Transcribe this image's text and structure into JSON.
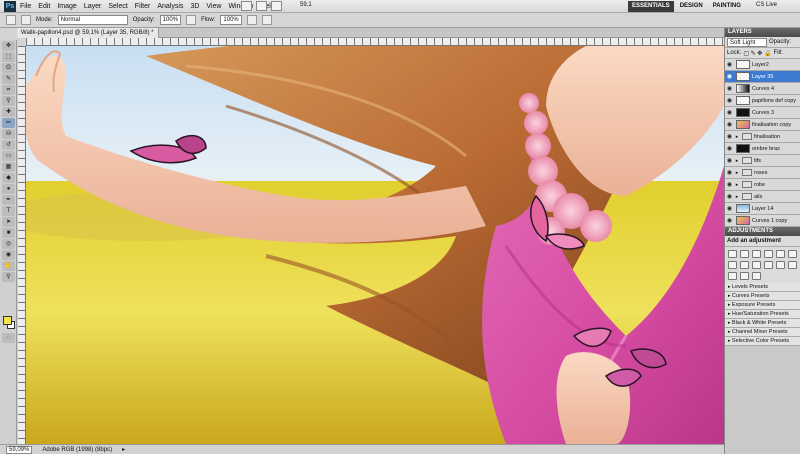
{
  "app": {
    "logo": "Ps"
  },
  "menubar": {
    "items": [
      "File",
      "Edit",
      "Image",
      "Layer",
      "Select",
      "Filter",
      "Analysis",
      "3D",
      "View",
      "Window",
      "Help"
    ],
    "zoom": "59,1",
    "workspaces": [
      "ESSENTIALS",
      "DESIGN",
      "PAINTING"
    ],
    "cs_live": "CS Live"
  },
  "options": {
    "mode_label": "Mode:",
    "mode_value": "Normal",
    "opacity_label": "Opacity:",
    "opacity_value": "100%",
    "flow_label": "Flow:",
    "flow_value": "100%"
  },
  "document": {
    "tab_title": "Wallk-papillon4.psd @ 59,1% (Layer 35, RGB/8) *"
  },
  "status": {
    "zoom": "59,09%",
    "profile": "Adobe RGB (1998) (8bpc)"
  },
  "layers_panel": {
    "title": "LAYERS",
    "blend_mode": "Soft Light",
    "opacity_label": "Opacity:",
    "lock_label": "Lock:",
    "fill_label": "Fill:",
    "layers": [
      {
        "name": "Layer2",
        "thumb": "trans",
        "selected": false
      },
      {
        "name": "Layer 35",
        "thumb": "trans",
        "selected": true
      },
      {
        "name": "Curves 4",
        "thumb": "grad",
        "selected": false
      },
      {
        "name": "papillons def copy",
        "thumb": "trans",
        "selected": false
      },
      {
        "name": "Curves 3",
        "thumb": "black",
        "selected": false
      },
      {
        "name": "finalisation copy",
        "thumb": "img",
        "selected": false
      },
      {
        "name": "finalisation",
        "thumb": "folder",
        "selected": false
      },
      {
        "name": "ombre bras",
        "thumb": "black",
        "selected": false
      },
      {
        "name": "tifs",
        "thumb": "folder",
        "selected": false
      },
      {
        "name": "roses",
        "thumb": "folder",
        "selected": false
      },
      {
        "name": "robe",
        "thumb": "folder",
        "selected": false
      },
      {
        "name": "ails",
        "thumb": "folder",
        "selected": false
      },
      {
        "name": "Layer 14",
        "thumb": "blue",
        "selected": false
      },
      {
        "name": "Curves 1 copy",
        "thumb": "img",
        "selected": false
      }
    ]
  },
  "adjustments_panel": {
    "title": "ADJUSTMENTS",
    "heading": "Add an adjustment",
    "presets": [
      "Levels Presets",
      "Curves Presets",
      "Exposure Presets",
      "Hue/Saturation Presets",
      "Black & White Presets",
      "Channel Mixer Presets",
      "Selective Color Presets"
    ]
  },
  "colors": {
    "foreground": "#f4e44c",
    "background": "#ffffff",
    "selected_layer": "#3d7bd2"
  }
}
